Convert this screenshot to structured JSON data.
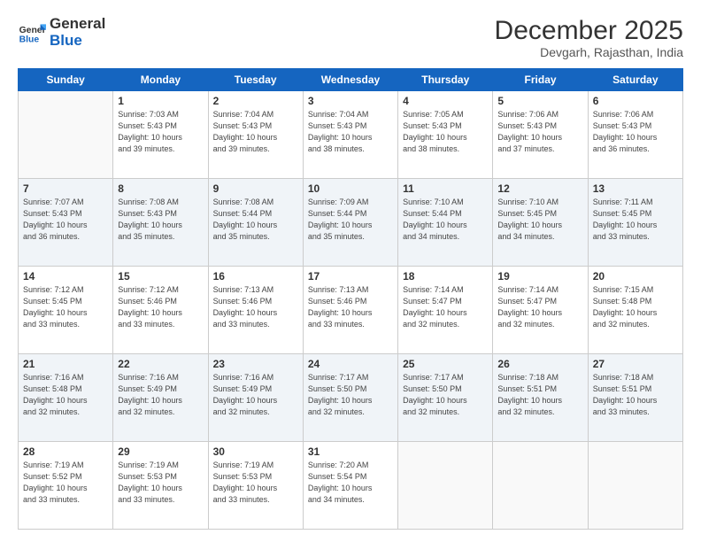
{
  "logo": {
    "line1": "General",
    "line2": "Blue"
  },
  "title": "December 2025",
  "location": "Devgarh, Rajasthan, India",
  "weekdays": [
    "Sunday",
    "Monday",
    "Tuesday",
    "Wednesday",
    "Thursday",
    "Friday",
    "Saturday"
  ],
  "weeks": [
    [
      {
        "day": "",
        "info": ""
      },
      {
        "day": "1",
        "info": "Sunrise: 7:03 AM\nSunset: 5:43 PM\nDaylight: 10 hours\nand 39 minutes."
      },
      {
        "day": "2",
        "info": "Sunrise: 7:04 AM\nSunset: 5:43 PM\nDaylight: 10 hours\nand 39 minutes."
      },
      {
        "day": "3",
        "info": "Sunrise: 7:04 AM\nSunset: 5:43 PM\nDaylight: 10 hours\nand 38 minutes."
      },
      {
        "day": "4",
        "info": "Sunrise: 7:05 AM\nSunset: 5:43 PM\nDaylight: 10 hours\nand 38 minutes."
      },
      {
        "day": "5",
        "info": "Sunrise: 7:06 AM\nSunset: 5:43 PM\nDaylight: 10 hours\nand 37 minutes."
      },
      {
        "day": "6",
        "info": "Sunrise: 7:06 AM\nSunset: 5:43 PM\nDaylight: 10 hours\nand 36 minutes."
      }
    ],
    [
      {
        "day": "7",
        "info": "Sunrise: 7:07 AM\nSunset: 5:43 PM\nDaylight: 10 hours\nand 36 minutes."
      },
      {
        "day": "8",
        "info": "Sunrise: 7:08 AM\nSunset: 5:43 PM\nDaylight: 10 hours\nand 35 minutes."
      },
      {
        "day": "9",
        "info": "Sunrise: 7:08 AM\nSunset: 5:44 PM\nDaylight: 10 hours\nand 35 minutes."
      },
      {
        "day": "10",
        "info": "Sunrise: 7:09 AM\nSunset: 5:44 PM\nDaylight: 10 hours\nand 35 minutes."
      },
      {
        "day": "11",
        "info": "Sunrise: 7:10 AM\nSunset: 5:44 PM\nDaylight: 10 hours\nand 34 minutes."
      },
      {
        "day": "12",
        "info": "Sunrise: 7:10 AM\nSunset: 5:45 PM\nDaylight: 10 hours\nand 34 minutes."
      },
      {
        "day": "13",
        "info": "Sunrise: 7:11 AM\nSunset: 5:45 PM\nDaylight: 10 hours\nand 33 minutes."
      }
    ],
    [
      {
        "day": "14",
        "info": "Sunrise: 7:12 AM\nSunset: 5:45 PM\nDaylight: 10 hours\nand 33 minutes."
      },
      {
        "day": "15",
        "info": "Sunrise: 7:12 AM\nSunset: 5:46 PM\nDaylight: 10 hours\nand 33 minutes."
      },
      {
        "day": "16",
        "info": "Sunrise: 7:13 AM\nSunset: 5:46 PM\nDaylight: 10 hours\nand 33 minutes."
      },
      {
        "day": "17",
        "info": "Sunrise: 7:13 AM\nSunset: 5:46 PM\nDaylight: 10 hours\nand 33 minutes."
      },
      {
        "day": "18",
        "info": "Sunrise: 7:14 AM\nSunset: 5:47 PM\nDaylight: 10 hours\nand 32 minutes."
      },
      {
        "day": "19",
        "info": "Sunrise: 7:14 AM\nSunset: 5:47 PM\nDaylight: 10 hours\nand 32 minutes."
      },
      {
        "day": "20",
        "info": "Sunrise: 7:15 AM\nSunset: 5:48 PM\nDaylight: 10 hours\nand 32 minutes."
      }
    ],
    [
      {
        "day": "21",
        "info": "Sunrise: 7:16 AM\nSunset: 5:48 PM\nDaylight: 10 hours\nand 32 minutes."
      },
      {
        "day": "22",
        "info": "Sunrise: 7:16 AM\nSunset: 5:49 PM\nDaylight: 10 hours\nand 32 minutes."
      },
      {
        "day": "23",
        "info": "Sunrise: 7:16 AM\nSunset: 5:49 PM\nDaylight: 10 hours\nand 32 minutes."
      },
      {
        "day": "24",
        "info": "Sunrise: 7:17 AM\nSunset: 5:50 PM\nDaylight: 10 hours\nand 32 minutes."
      },
      {
        "day": "25",
        "info": "Sunrise: 7:17 AM\nSunset: 5:50 PM\nDaylight: 10 hours\nand 32 minutes."
      },
      {
        "day": "26",
        "info": "Sunrise: 7:18 AM\nSunset: 5:51 PM\nDaylight: 10 hours\nand 32 minutes."
      },
      {
        "day": "27",
        "info": "Sunrise: 7:18 AM\nSunset: 5:51 PM\nDaylight: 10 hours\nand 33 minutes."
      }
    ],
    [
      {
        "day": "28",
        "info": "Sunrise: 7:19 AM\nSunset: 5:52 PM\nDaylight: 10 hours\nand 33 minutes."
      },
      {
        "day": "29",
        "info": "Sunrise: 7:19 AM\nSunset: 5:53 PM\nDaylight: 10 hours\nand 33 minutes."
      },
      {
        "day": "30",
        "info": "Sunrise: 7:19 AM\nSunset: 5:53 PM\nDaylight: 10 hours\nand 33 minutes."
      },
      {
        "day": "31",
        "info": "Sunrise: 7:20 AM\nSunset: 5:54 PM\nDaylight: 10 hours\nand 34 minutes."
      },
      {
        "day": "",
        "info": ""
      },
      {
        "day": "",
        "info": ""
      },
      {
        "day": "",
        "info": ""
      }
    ]
  ]
}
